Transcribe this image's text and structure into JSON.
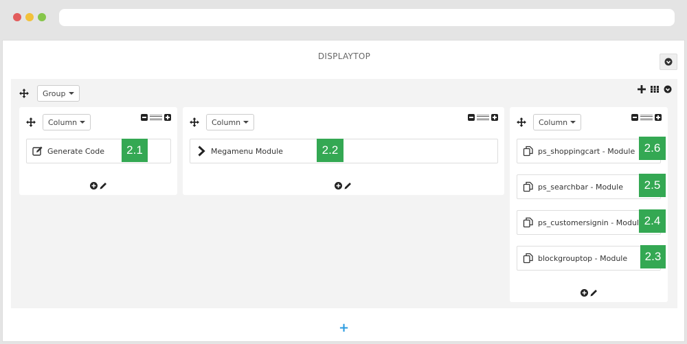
{
  "hook": {
    "title": "DISPLAYTOP"
  },
  "group": {
    "dropdown_label": "Group"
  },
  "columns": [
    {
      "dropdown_label": "Column",
      "modules": [
        {
          "label": "Generate Code",
          "icon": "edit-icon",
          "badge": "2.1"
        }
      ]
    },
    {
      "dropdown_label": "Column",
      "modules": [
        {
          "label": "Megamenu Module",
          "icon": "chevron-right-icon",
          "badge": "2.2"
        }
      ]
    },
    {
      "dropdown_label": "Column",
      "modules": [
        {
          "label": "ps_shoppingcart - Module",
          "icon": "copy-icon",
          "badge": "2.6"
        },
        {
          "label": "ps_searchbar - Module",
          "icon": "copy-icon",
          "badge": "2.5"
        },
        {
          "label": "ps_customersignin - Module",
          "icon": "copy-icon",
          "badge": "2.4"
        },
        {
          "label": "blockgrouptop - Module",
          "icon": "copy-icon",
          "badge": "2.3"
        }
      ]
    }
  ],
  "add_row_label": "+",
  "colors": {
    "badge": "#34a853",
    "add": "#2a9be0",
    "group_bg": "#f3f3f3"
  }
}
